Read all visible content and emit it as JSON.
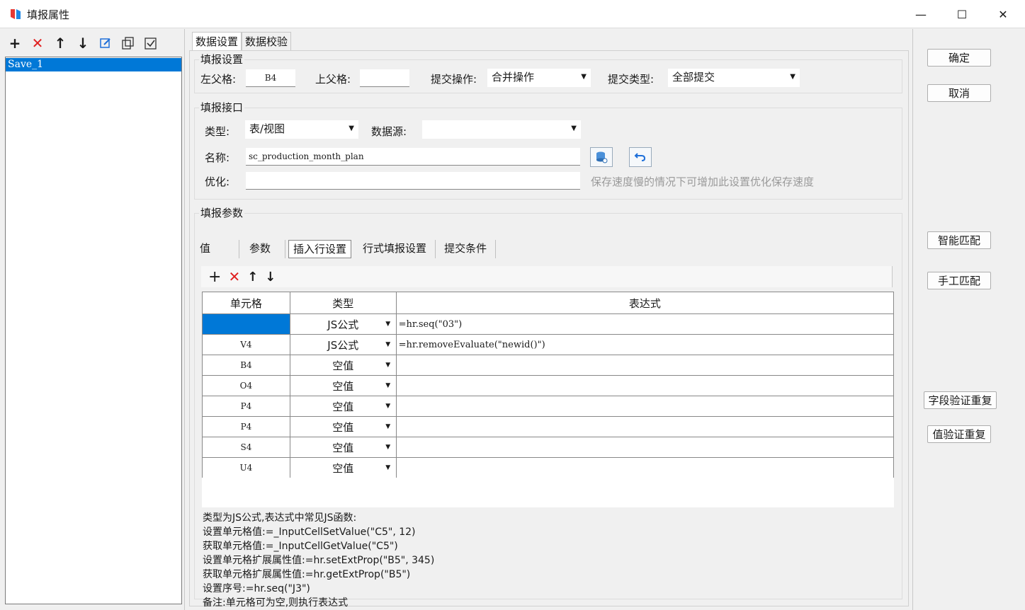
{
  "window": {
    "title": "填报属性",
    "min": "—",
    "max": "☐",
    "close": "✕"
  },
  "left": {
    "items": [
      "Save_1"
    ]
  },
  "tabs": [
    "数据设置",
    "数据校验"
  ],
  "fill_settings": {
    "group_title": "填报设置",
    "left_parent_label": "左父格:",
    "left_parent_value": "B4",
    "top_parent_label": "上父格:",
    "top_parent_value": "",
    "submit_op_label": "提交操作:",
    "submit_op_value": "合并操作",
    "submit_type_label": "提交类型:",
    "submit_type_value": "全部提交"
  },
  "interface": {
    "group_title": "填报接口",
    "type_label": "类型:",
    "type_value": "表/视图",
    "datasource_label": "数据源:",
    "datasource_value": "",
    "name_label": "名称:",
    "name_value": "sc_production_month_plan",
    "optimize_label": "优化:",
    "optimize_value": "",
    "optimize_hint": "保存速度慢的情况下可增加此设置优化保存速度"
  },
  "params": {
    "group_title": "填报参数",
    "tabs": [
      "值",
      "参数",
      "插入行设置",
      "行式填报设置",
      "提交条件"
    ],
    "columns": [
      "单元格",
      "类型",
      "表达式"
    ],
    "rows": [
      {
        "cell": "",
        "type": "JS公式",
        "expr": "=hr.seq(\"03\")"
      },
      {
        "cell": "V4",
        "type": "JS公式",
        "expr": "=hr.removeEvaluate(\"newid()\")"
      },
      {
        "cell": "B4",
        "type": "空值",
        "expr": ""
      },
      {
        "cell": "O4",
        "type": "空值",
        "expr": ""
      },
      {
        "cell": "P4",
        "type": "空值",
        "expr": ""
      },
      {
        "cell": "P4",
        "type": "空值",
        "expr": ""
      },
      {
        "cell": "S4",
        "type": "空值",
        "expr": ""
      },
      {
        "cell": "U4",
        "type": "空值",
        "expr": ""
      }
    ]
  },
  "help_lines": [
    "类型为JS公式,表达式中常见JS函数:",
    "设置单元格值:=_InputCellSetValue(\"C5\", 12)",
    "获取单元格值:=_InputCellGetValue(\"C5\")",
    "设置单元格扩展属性值:=hr.setExtProp(\"B5\", 345)",
    "获取单元格扩展属性值:=hr.getExtProp(\"B5\")",
    "设置序号:=hr.seq(\"J3\")",
    "备注:单元格可为空,则执行表达式"
  ],
  "right": {
    "ok": "确定",
    "cancel": "取消",
    "smart_match": "智能匹配",
    "manual_match": "手工匹配",
    "field_dup": "字段验证重复",
    "value_dup": "值验证重复"
  },
  "colors": {
    "selection": "#0078d7",
    "delete": "#e02020"
  }
}
